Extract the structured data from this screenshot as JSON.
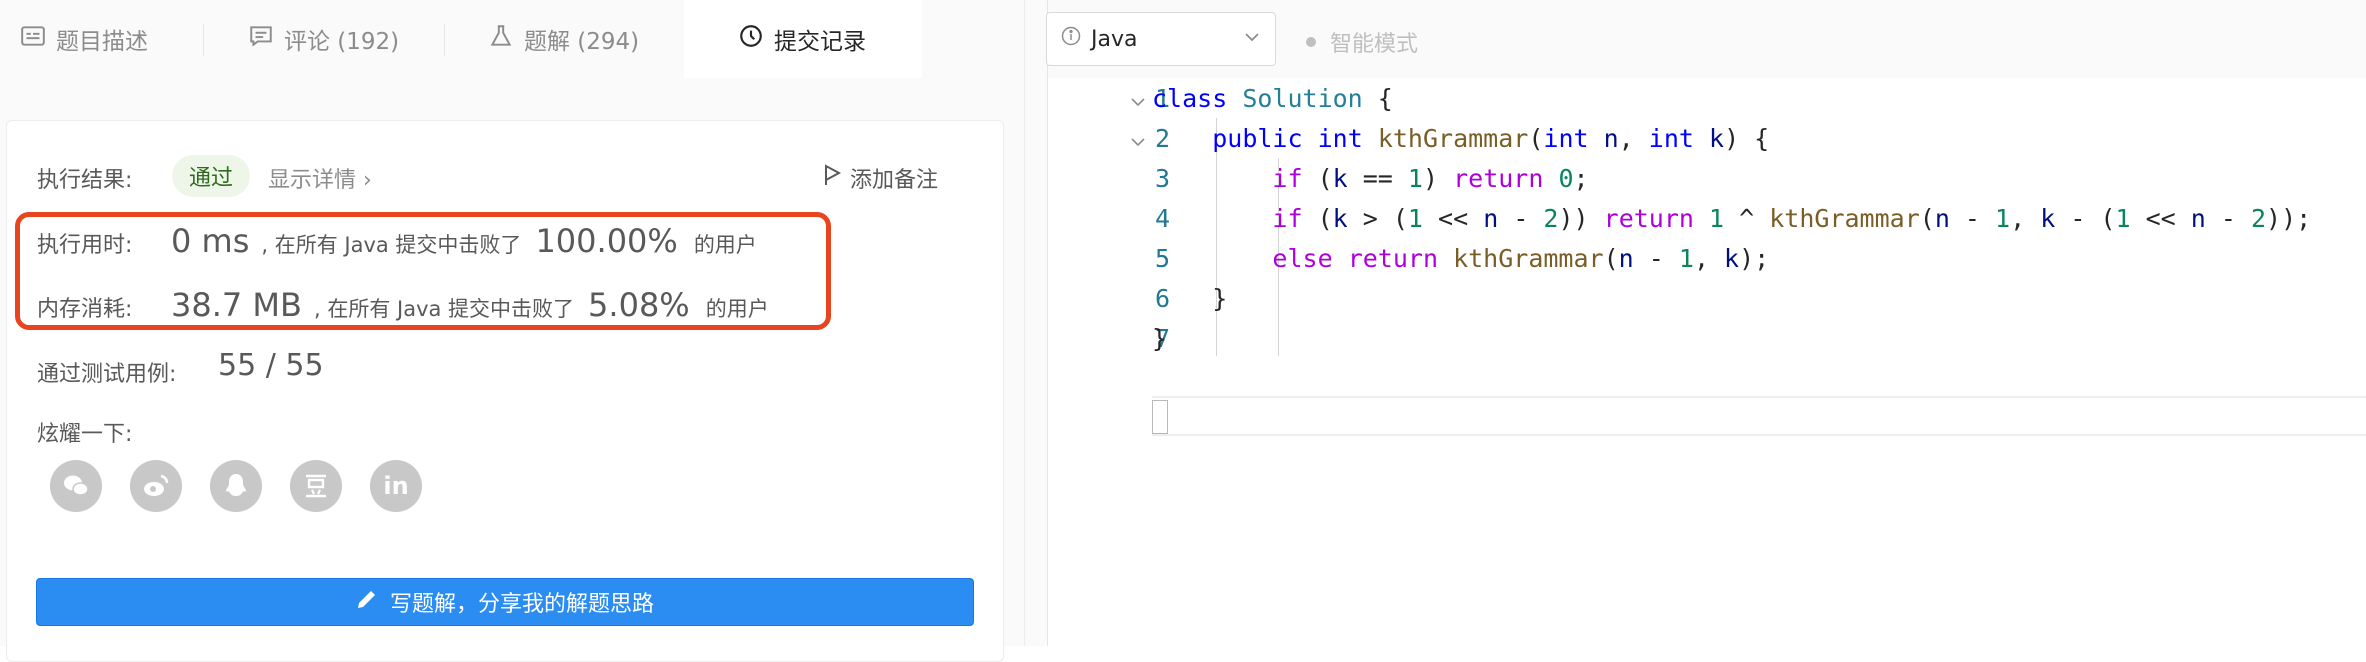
{
  "tabs": [
    {
      "label": "题目描述",
      "icon": "description-icon"
    },
    {
      "label": "评论 (192)",
      "icon": "comment-icon"
    },
    {
      "label": "题解 (294)",
      "icon": "flask-icon"
    },
    {
      "label": "提交记录",
      "icon": "clock-icon",
      "active": true
    }
  ],
  "result": {
    "label": "执行结果:",
    "status": "通过",
    "detail_link": "显示详情 ›",
    "add_note": "添加备注",
    "runtime": {
      "label": "执行用时:",
      "value": "0 ms",
      "mid": ", 在所有 Java 提交中击败了",
      "percent": "100.00%",
      "suffix": "的用户"
    },
    "memory": {
      "label": "内存消耗:",
      "value": "38.7 MB",
      "mid": ", 在所有 Java 提交中击败了",
      "percent": "5.08%",
      "suffix": "的用户"
    },
    "tests_label": "通过测试用例:",
    "tests_value": "55 / 55",
    "share_label": "炫耀一下:",
    "share_icons": [
      "wechat-icon",
      "weibo-icon",
      "qq-icon",
      "douban-icon",
      "linkedin-icon"
    ],
    "write_button": "写题解，分享我的解题思路"
  },
  "editor": {
    "language": "Java",
    "mode": "智能模式",
    "line_numbers": [
      "1",
      "2",
      "3",
      "4",
      "5",
      "6",
      "7"
    ],
    "code_lines": [
      "class Solution {",
      "    public int kthGrammar(int n, int k) {",
      "        if (k == 1) return 0;",
      "        if (k > (1 << n - 2)) return 1 ^ kthGrammar(n - 1, k - (1 << n - 2));",
      "        else return kthGrammar(n - 1, k);",
      "    }",
      "}"
    ]
  },
  "colors": {
    "accent": "#2b8cf2",
    "highlight": "#e8441f",
    "pass_badge_bg": "#eef6ea",
    "pass_badge_text": "#2f6b1d"
  }
}
